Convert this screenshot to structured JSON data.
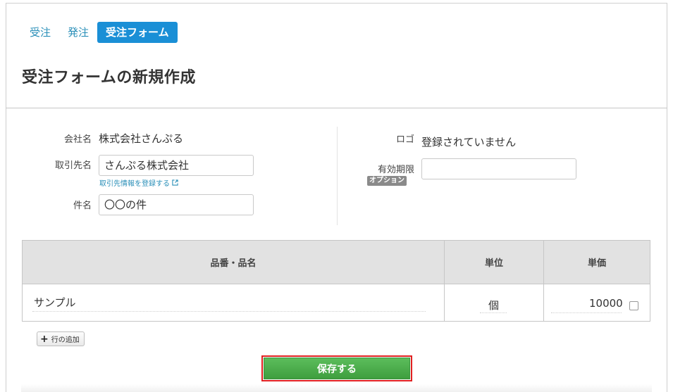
{
  "tabs": [
    {
      "label": "受注"
    },
    {
      "label": "発注"
    },
    {
      "label": "受注フォーム"
    }
  ],
  "page_title": "受注フォームの新規作成",
  "form": {
    "company": {
      "label": "会社名",
      "value": "株式会社さんぷる"
    },
    "client": {
      "label": "取引先名",
      "value": "さんぷる株式会社",
      "link": "取引先情報を登録する"
    },
    "subject": {
      "label": "件名",
      "value": "〇〇の件"
    },
    "logo": {
      "label": "ロゴ",
      "value": "登録されていません"
    },
    "expiry": {
      "label": "有効期限",
      "badge": "オプション",
      "value": ""
    }
  },
  "table": {
    "headers": [
      "品番・品名",
      "単位",
      "単価"
    ],
    "rows": [
      {
        "name": "サンプル",
        "unit": "個",
        "price": "10000"
      }
    ]
  },
  "add_row_label": "行の追加",
  "save_label": "保存する",
  "colors": {
    "accent": "#1a8fd6",
    "save": "#4caf50",
    "highlight": "#e02020"
  }
}
